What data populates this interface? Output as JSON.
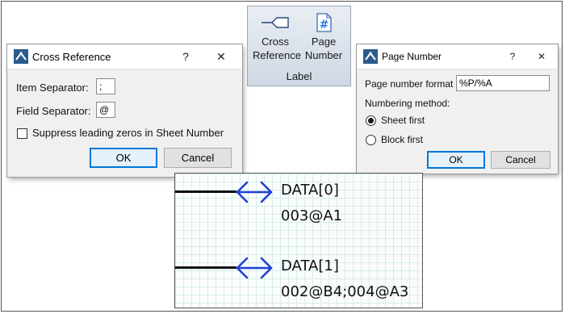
{
  "cross_reference_dialog": {
    "title": "Cross Reference",
    "help_glyph": "?",
    "close_glyph": "✕",
    "item_separator_label": "Item Separator:",
    "item_separator_value": ";",
    "field_separator_label": "Field Separator:",
    "field_separator_value": "@",
    "suppress_zeros_label": "Suppress leading zeros in Sheet Number",
    "suppress_zeros_checked": false,
    "ok_label": "OK",
    "cancel_label": "Cancel"
  },
  "ribbon": {
    "cross_reference_label_line1": "Cross",
    "cross_reference_label_line2": "Reference",
    "page_number_label_line1": "Page",
    "page_number_label_line2": "Number",
    "group_label": "Label",
    "page_icon_glyph": "#"
  },
  "page_number_dialog": {
    "title": "Page Number",
    "help_glyph": "?",
    "close_glyph": "✕",
    "format_label": "Page number format",
    "format_value": "%P/%A",
    "numbering_method_label": "Numbering method:",
    "sheet_first_label": "Sheet first",
    "block_first_label": "Block first",
    "selected_method": "Sheet first",
    "ok_label": "OK",
    "cancel_label": "Cancel"
  },
  "schematic": {
    "nets": [
      {
        "name": "DATA[0]",
        "xref": "003@A1"
      },
      {
        "name": "DATA[1]",
        "xref": "002@B4;004@A3"
      }
    ],
    "port_color": "#1f3fd6"
  },
  "colors": {
    "accent": "#0078d7",
    "icon_blue": "#2b5b8c"
  }
}
